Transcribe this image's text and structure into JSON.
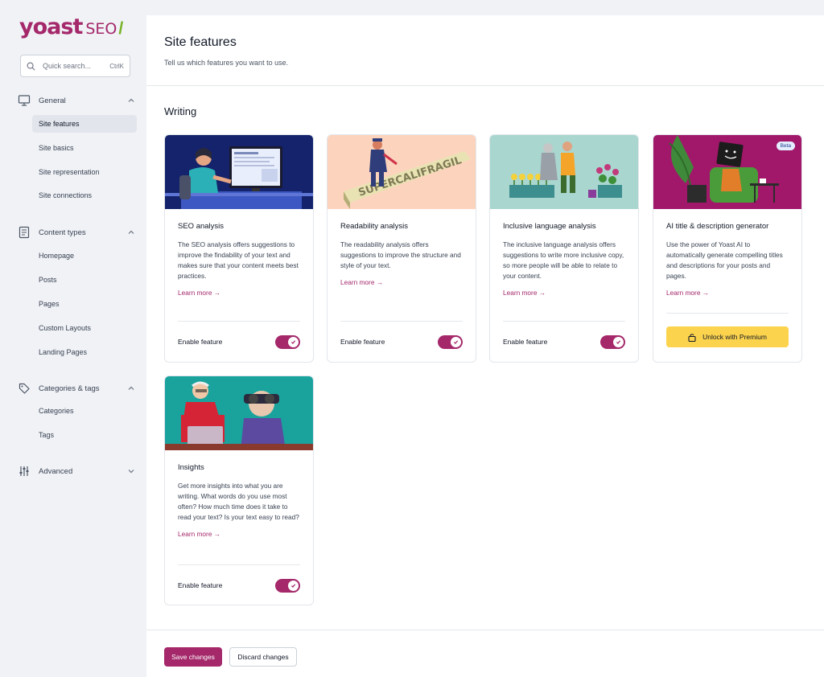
{
  "brand": {
    "name": "yoast",
    "product": "SEO",
    "accent": "#a4286a",
    "slash_color": "#77b227"
  },
  "search": {
    "placeholder": "Quick search...",
    "shortcut": "CtrlK"
  },
  "sidebar": {
    "groups": [
      {
        "label": "General",
        "icon": "monitor-icon",
        "expanded": true,
        "items": [
          {
            "label": "Site features",
            "active": true
          },
          {
            "label": "Site basics"
          },
          {
            "label": "Site representation"
          },
          {
            "label": "Site connections"
          }
        ]
      },
      {
        "label": "Content types",
        "icon": "document-icon",
        "expanded": true,
        "items": [
          {
            "label": "Homepage"
          },
          {
            "label": "Posts"
          },
          {
            "label": "Pages"
          },
          {
            "label": "Custom Layouts"
          },
          {
            "label": "Landing Pages"
          }
        ]
      },
      {
        "label": "Categories & tags",
        "icon": "tag-icon",
        "expanded": true,
        "items": [
          {
            "label": "Categories"
          },
          {
            "label": "Tags"
          }
        ]
      },
      {
        "label": "Advanced",
        "icon": "sliders-icon",
        "expanded": false,
        "items": []
      }
    ]
  },
  "header": {
    "title": "Site features",
    "subtitle": "Tell us which features you want to use."
  },
  "section": {
    "title": "Writing"
  },
  "cards": [
    {
      "title": "SEO analysis",
      "description": "The SEO analysis offers suggestions to improve the findability of your text and makes sure that your content meets best practices.",
      "learn_more": "Learn more →",
      "footer_label": "Enable feature",
      "enabled": true
    },
    {
      "title": "Readability analysis",
      "description": "The readability analysis offers suggestions to improve the structure and style of your text.",
      "learn_more": "Learn more →",
      "footer_label": "Enable feature",
      "enabled": true
    },
    {
      "title": "Inclusive language analysis",
      "description": "The inclusive language analysis offers suggestions to write more inclusive copy, so more people will be able to relate to your content.",
      "learn_more": "Learn more →",
      "footer_label": "Enable feature",
      "enabled": true
    },
    {
      "title": "AI title & description generator",
      "description": "Use the power of Yoast AI to automatically generate compelling titles and descriptions for your posts and pages.",
      "learn_more": "Learn more →",
      "badge": "Beta",
      "premium_button": "Unlock with Premium"
    },
    {
      "title": "Insights",
      "description": "Get more insights into what you are writing. What words do you use most often? How much time does it take to read your text? Is your text easy to read?",
      "learn_more": "Learn more →",
      "footer_label": "Enable feature",
      "enabled": true
    }
  ],
  "footer": {
    "save": "Save changes",
    "discard": "Discard changes"
  }
}
